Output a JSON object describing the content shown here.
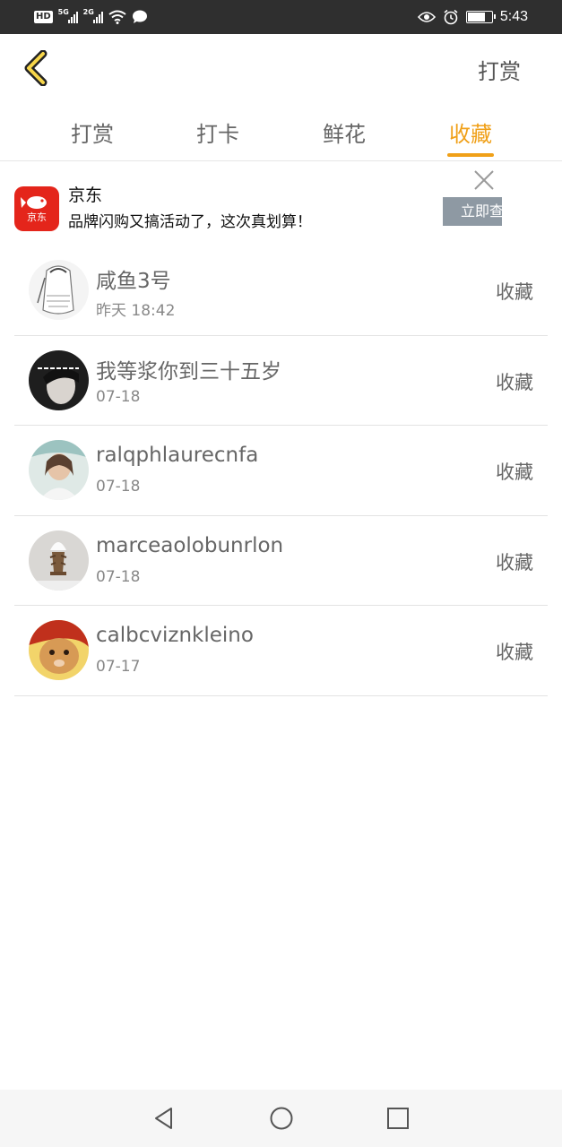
{
  "status_bar": {
    "left_icons": [
      "hd-icon",
      "signal-5g-icon",
      "signal-2g-icon",
      "wifi-icon",
      "message-icon"
    ],
    "net_labels": [
      "5G",
      "2G"
    ],
    "hd_label": "HD",
    "right_icons": [
      "eye-icon",
      "alarm-icon",
      "battery-icon"
    ],
    "battery_level": 0.75,
    "time": "5:43"
  },
  "header": {
    "back_icon": "chevron-left-icon",
    "action_label": "打赏"
  },
  "tabs": {
    "items": [
      "打赏",
      "打卡",
      "鲜花",
      "收藏"
    ],
    "active_index": 3,
    "accent_color": "#f0a018"
  },
  "ad": {
    "logo_label": "京东",
    "title": "京东",
    "description": "品牌闪购又搞活动了，这次真划算！",
    "button_label": "立即查",
    "close_icon": "close-icon"
  },
  "list": {
    "items": [
      {
        "name": "咸鱼3号",
        "date": "昨天 18:42",
        "action": "收藏"
      },
      {
        "name": "我等浆你到三十五岁",
        "date": "07-18",
        "action": "收藏"
      },
      {
        "name": "ralqphlaurecnfa",
        "date": "07-18",
        "action": "收藏"
      },
      {
        "name": "marceaolobunrlon",
        "date": "07-18",
        "action": "收藏"
      },
      {
        "name": "calbcviznkleino",
        "date": "07-17",
        "action": "收藏"
      }
    ]
  },
  "nav_bar": {
    "icons": [
      "back-triangle-icon",
      "home-circle-icon",
      "recents-square-icon"
    ]
  }
}
